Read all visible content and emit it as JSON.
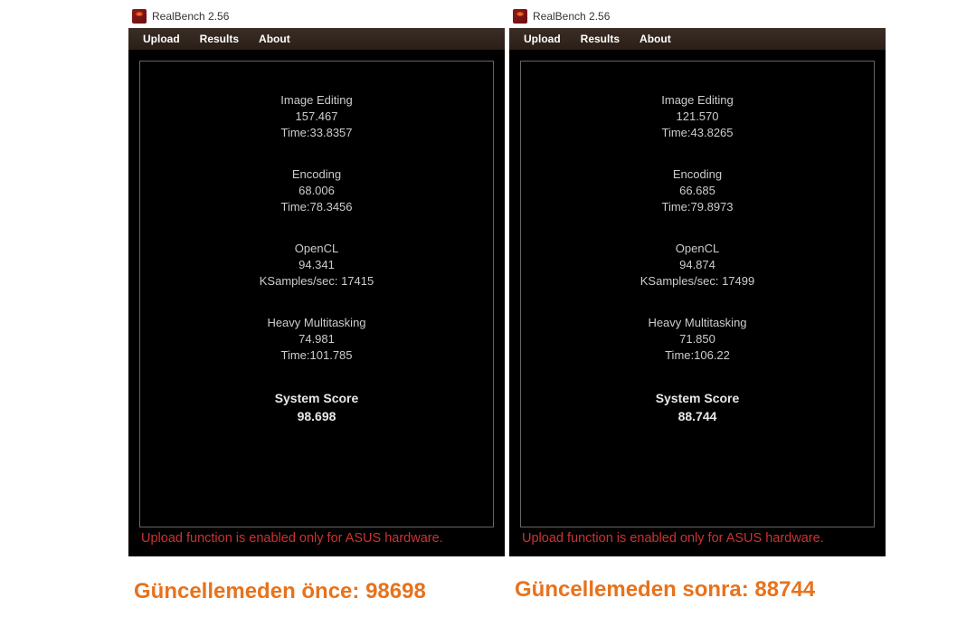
{
  "app_title": "RealBench 2.56",
  "menu": {
    "upload": "Upload",
    "results": "Results",
    "about": "About"
  },
  "labels": {
    "image_editing": "Image Editing",
    "encoding": "Encoding",
    "opencl": "OpenCL",
    "heavy": "Heavy Multitasking",
    "system_score": "System Score",
    "time_prefix": "Time:",
    "ksamples_prefix": "KSamples/sec: "
  },
  "left": {
    "image_editing": {
      "score": "157.467",
      "time": "33.8357"
    },
    "encoding": {
      "score": "68.006",
      "time": "78.3456"
    },
    "opencl": {
      "score": "94.341",
      "ksamples": "17415"
    },
    "heavy": {
      "score": "74.981",
      "time": "101.785"
    },
    "system_score": "98.698"
  },
  "right": {
    "image_editing": {
      "score": "121.570",
      "time": "43.8265"
    },
    "encoding": {
      "score": "66.685",
      "time": "79.8973"
    },
    "opencl": {
      "score": "94.874",
      "ksamples": "17499"
    },
    "heavy": {
      "score": "71.850",
      "time": "106.22"
    },
    "system_score": "88.744"
  },
  "footer_msg": "Upload function is enabled only for ASUS hardware.",
  "captions": {
    "before": "Güncellemeden önce: 98698",
    "after": "Güncellemeden sonra: 88744"
  }
}
